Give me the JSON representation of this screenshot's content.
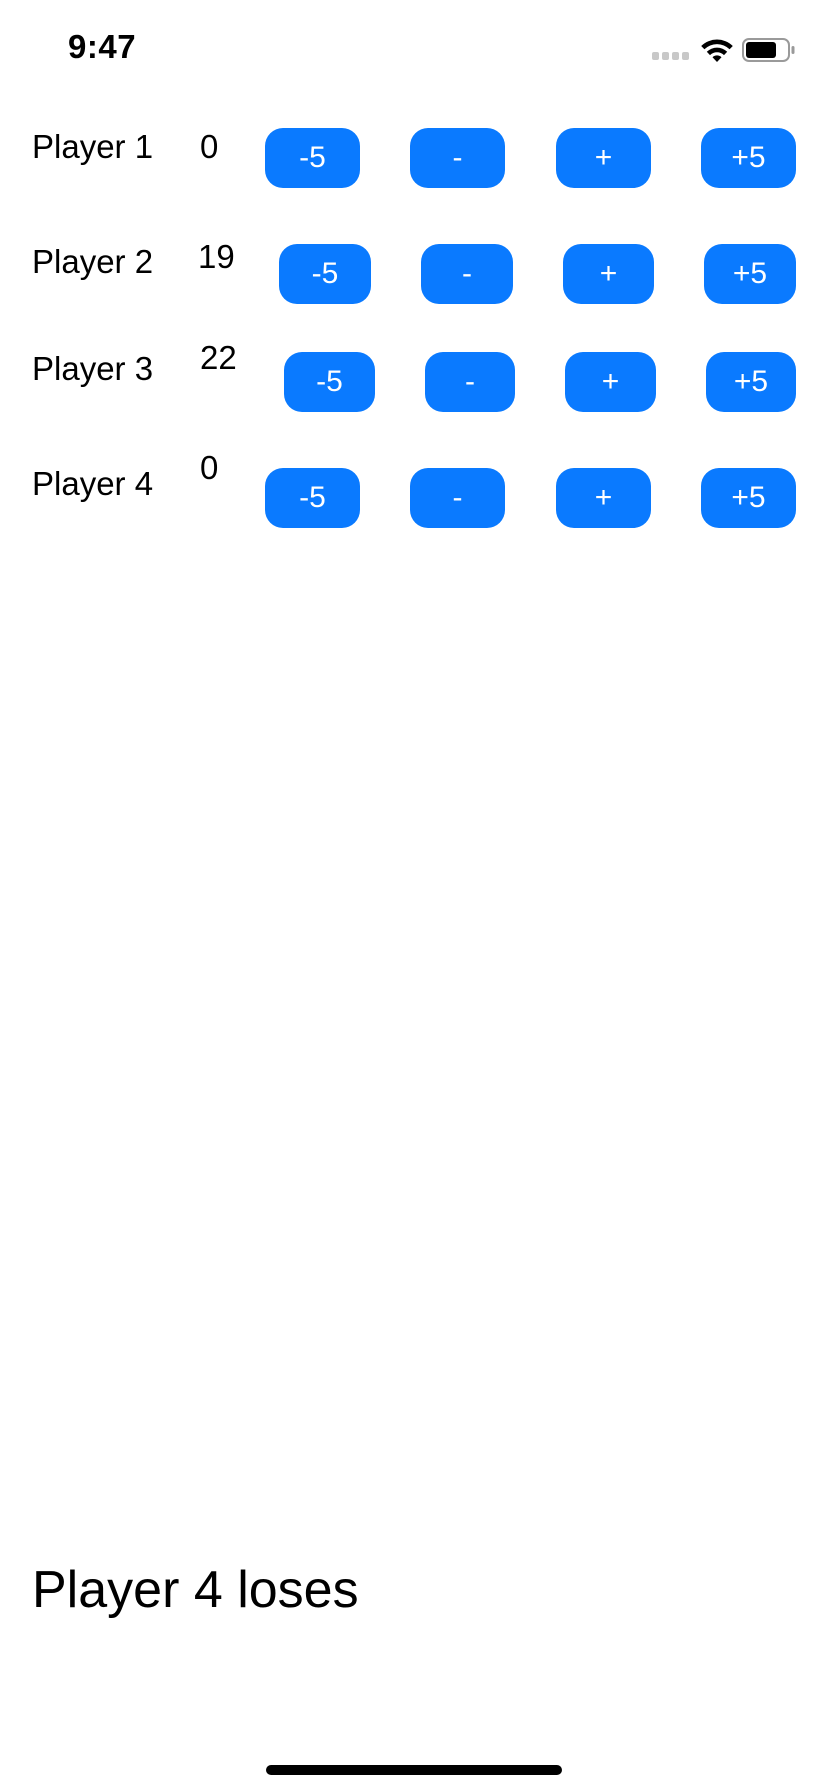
{
  "status_bar": {
    "time": "9:47",
    "icons": [
      "cellular-dots-icon",
      "wifi-icon",
      "battery-icon"
    ]
  },
  "accent_color": "#0a7aff",
  "button_labels": {
    "minus_five": "-5",
    "minus_one": "-",
    "plus_one": "+",
    "plus_five": "+5"
  },
  "players": [
    {
      "name": "Player 1",
      "score": "0"
    },
    {
      "name": "Player 2",
      "score": "19"
    },
    {
      "name": "Player 3",
      "score": "22"
    },
    {
      "name": "Player 4",
      "score": "0"
    }
  ],
  "result": "Player 4 loses"
}
